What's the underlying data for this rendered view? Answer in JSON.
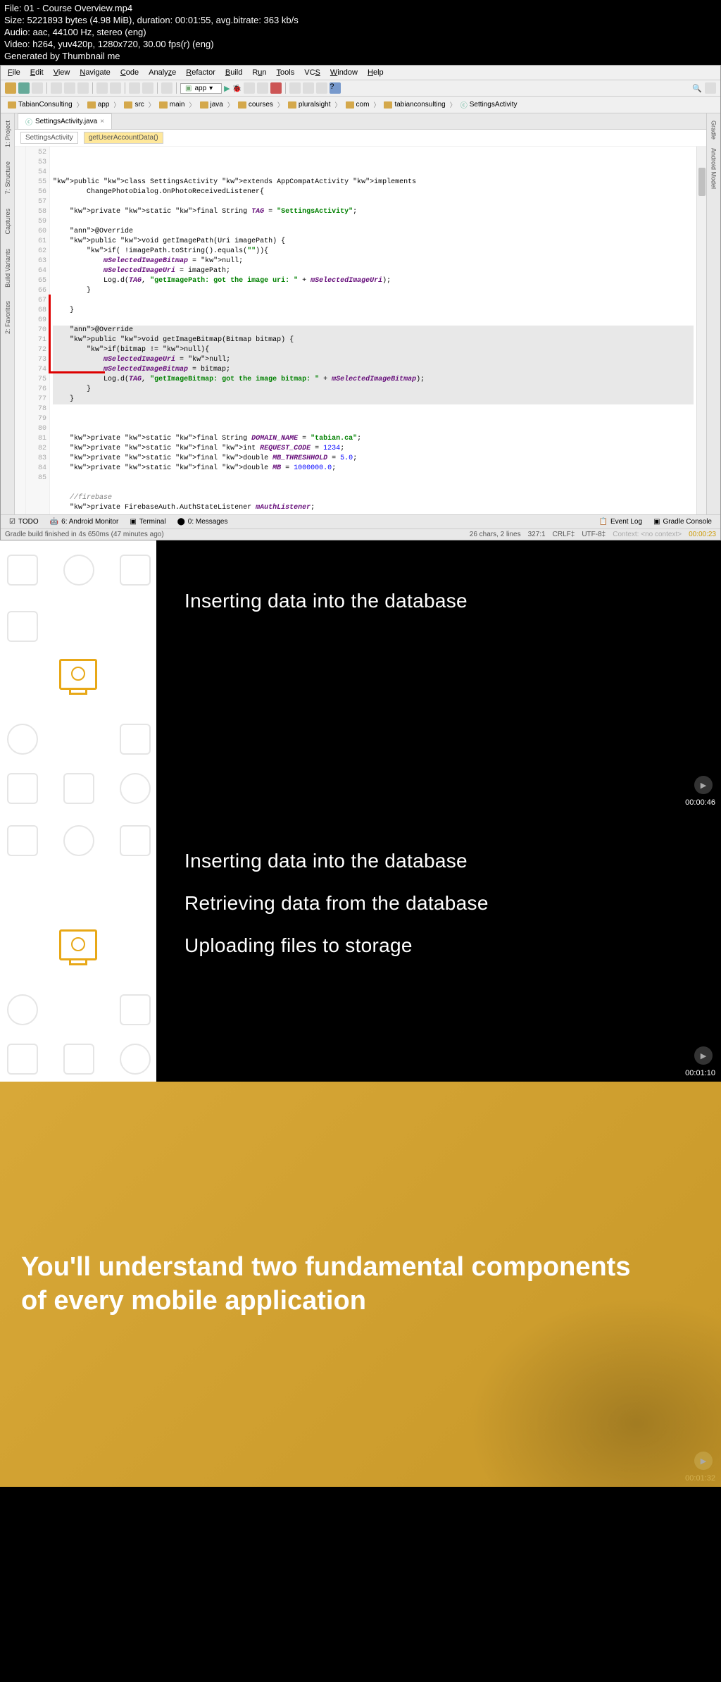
{
  "header": {
    "file_line": "File: 01 - Course Overview.mp4",
    "size_line": "Size: 5221893 bytes (4.98 MiB), duration: 00:01:55, avg.bitrate: 363 kb/s",
    "audio_line": "Audio: aac, 44100 Hz, stereo (eng)",
    "video_line": "Video: h264, yuv420p, 1280x720, 30.00 fps(r) (eng)",
    "gen_line": "Generated by Thumbnail me"
  },
  "ide": {
    "menus": [
      "File",
      "Edit",
      "View",
      "Navigate",
      "Code",
      "Analyze",
      "Refactor",
      "Build",
      "Run",
      "Tools",
      "VCS",
      "Window",
      "Help"
    ],
    "run_config": "app",
    "breadcrumb": [
      "TabianConsulting",
      "app",
      "src",
      "main",
      "java",
      "courses",
      "pluralsight",
      "com",
      "tabianconsulting",
      "SettingsActivity"
    ],
    "tab_name": "SettingsActivity.java",
    "crumb_class": "SettingsActivity",
    "crumb_method": "getUserAccountData()",
    "left_tabs": [
      "1: Project",
      "7: Structure",
      "Captures",
      "Build Variants",
      "2: Favorites"
    ],
    "right_tabs": [
      "Gradle",
      "Android Model"
    ],
    "line_start": 52,
    "code_lines": [
      {
        "n": 52,
        "t": "public class SettingsActivity extends AppCompatActivity implements",
        "c": "kw"
      },
      {
        "n": 53,
        "t": "        ChangePhotoDialog.OnPhotoReceivedListener{"
      },
      {
        "n": 54,
        "t": ""
      },
      {
        "n": 55,
        "t": "    private static final String TAG = \"SettingsActivity\";"
      },
      {
        "n": 56,
        "t": ""
      },
      {
        "n": 57,
        "t": "    @Override"
      },
      {
        "n": 58,
        "t": "    public void getImagePath(Uri imagePath) {"
      },
      {
        "n": 59,
        "t": "        if( !imagePath.toString().equals(\"\")){"
      },
      {
        "n": 60,
        "t": "            mSelectedImageBitmap = null;"
      },
      {
        "n": 61,
        "t": "            mSelectedImageUri = imagePath;"
      },
      {
        "n": 62,
        "t": "            Log.d(TAG, \"getImagePath: got the image uri: \" + mSelectedImageUri);"
      },
      {
        "n": 63,
        "t": "        }"
      },
      {
        "n": 64,
        "t": ""
      },
      {
        "n": 65,
        "t": "    }"
      },
      {
        "n": 66,
        "t": ""
      },
      {
        "n": 67,
        "t": "    @Override",
        "hl": true
      },
      {
        "n": 68,
        "t": "    public void getImageBitmap(Bitmap bitmap) {",
        "hl": true
      },
      {
        "n": 69,
        "t": "        if(bitmap != null){",
        "hl": true
      },
      {
        "n": 70,
        "t": "            mSelectedImageUri = null;",
        "hl": true
      },
      {
        "n": 71,
        "t": "            mSelectedImageBitmap = bitmap;",
        "hl": true
      },
      {
        "n": 72,
        "t": "            Log.d(TAG, \"getImageBitmap: got the image bitmap: \" + mSelectedImageBitmap);",
        "hl": true
      },
      {
        "n": 73,
        "t": "        }",
        "hl": true
      },
      {
        "n": 74,
        "t": "    }",
        "hl": true
      },
      {
        "n": 75,
        "t": ""
      },
      {
        "n": 76,
        "t": ""
      },
      {
        "n": 77,
        "t": ""
      },
      {
        "n": 78,
        "t": "    private static final String DOMAIN_NAME = \"tabian.ca\";"
      },
      {
        "n": 79,
        "t": "    private static final int REQUEST_CODE = 1234;"
      },
      {
        "n": 80,
        "t": "    private static final double MB_THRESHHOLD = 5.0;"
      },
      {
        "n": 81,
        "t": "    private static final double MB = 1000000.0;"
      },
      {
        "n": 82,
        "t": ""
      },
      {
        "n": 83,
        "t": ""
      },
      {
        "n": 84,
        "t": "    //firebase"
      },
      {
        "n": 85,
        "t": "    private FirebaseAuth.AuthStateListener mAuthListener;"
      }
    ],
    "bottom_tabs": {
      "todo": "TODO",
      "android": "6: Android Monitor",
      "terminal": "Terminal",
      "messages": "0: Messages",
      "eventlog": "Event Log",
      "gradle": "Gradle Console"
    },
    "status_left": "Gradle build finished in 4s 650ms (47 minutes ago)",
    "status_chars": "26 chars, 2 lines",
    "status_pos": "327:1",
    "status_crlf": "CRLF‡",
    "status_enc": "UTF-8‡",
    "status_context": "Context: <no context>",
    "status_time": "00:00:23"
  },
  "slide1": {
    "title": "Inserting data into the database",
    "timestamp": "00:00:46"
  },
  "slide2": {
    "line1": "Inserting data into the database",
    "line2": "Retrieving data from the database",
    "line3": "Uploading files to storage",
    "timestamp": "00:01:10"
  },
  "slide3": {
    "text": "You'll understand two fundamental components of every mobile application",
    "timestamp": "00:01:32"
  }
}
